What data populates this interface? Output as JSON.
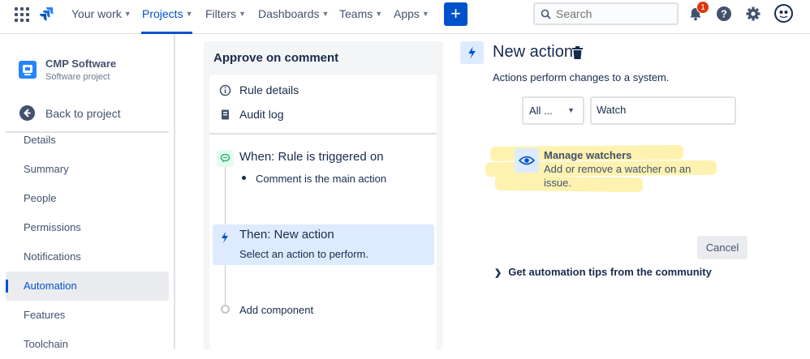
{
  "nav": {
    "items": [
      {
        "label": "Your work"
      },
      {
        "label": "Projects"
      },
      {
        "label": "Filters"
      },
      {
        "label": "Dashboards"
      },
      {
        "label": "Teams"
      },
      {
        "label": "Apps"
      }
    ],
    "search_placeholder": "Search",
    "notification_count": "1",
    "accent": "#0052cc"
  },
  "sidebar": {
    "project_name": "CMP Software",
    "project_type": "Software project",
    "back_label": "Back to project",
    "items": [
      {
        "label": "Details"
      },
      {
        "label": "Summary"
      },
      {
        "label": "People"
      },
      {
        "label": "Permissions"
      },
      {
        "label": "Notifications"
      },
      {
        "label": "Automation"
      },
      {
        "label": "Features"
      },
      {
        "label": "Toolchain"
      }
    ],
    "active_item": "Automation"
  },
  "rule": {
    "title": "Approve on comment",
    "menu": [
      {
        "label": "Rule details",
        "icon": "info-icon"
      },
      {
        "label": "Audit log",
        "icon": "document-icon"
      }
    ],
    "trigger": {
      "title": "When: Rule is triggered on",
      "condition": "Comment is the main action"
    },
    "action": {
      "title": "Then: New action",
      "subtitle": "Select an action to perform."
    },
    "add_component_label": "Add component"
  },
  "panel": {
    "title": "New action",
    "description": "Actions perform changes to a system.",
    "category_select": "All ...",
    "search_value": "Watch",
    "result": {
      "title": "Manage watchers",
      "description": "Add or remove a watcher on an issue."
    },
    "cancel_label": "Cancel",
    "tips_label": "Get automation tips from the community"
  }
}
